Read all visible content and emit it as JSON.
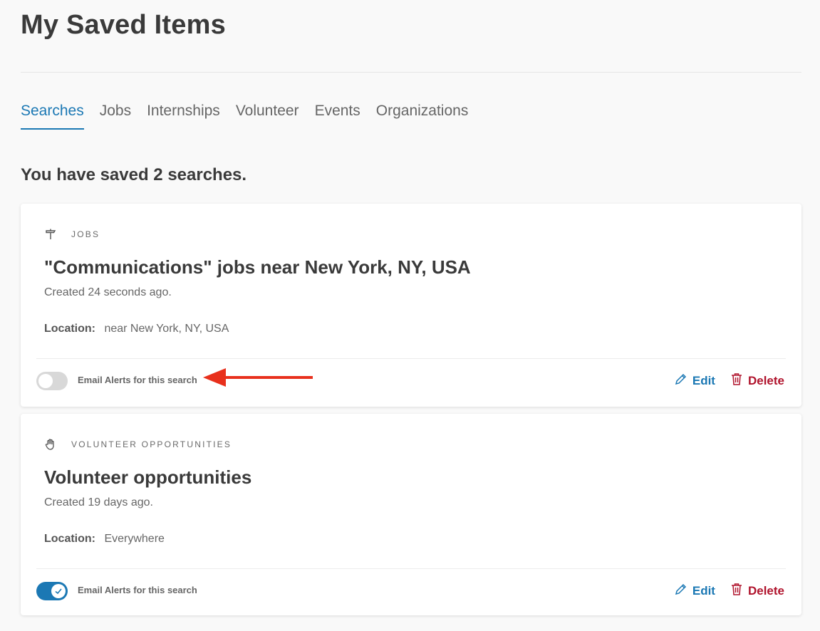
{
  "page": {
    "title": "My Saved Items"
  },
  "tabs": [
    {
      "label": "Searches",
      "active": true
    },
    {
      "label": "Jobs",
      "active": false
    },
    {
      "label": "Internships",
      "active": false
    },
    {
      "label": "Volunteer",
      "active": false
    },
    {
      "label": "Events",
      "active": false
    },
    {
      "label": "Organizations",
      "active": false
    }
  ],
  "summary": "You have saved 2 searches.",
  "searches": [
    {
      "category": "JOBS",
      "category_icon": "signpost-icon",
      "title": "\"Communications\" jobs near New York, NY, USA",
      "created": "Created 24 seconds ago.",
      "location_label": "Location:",
      "location_value": "near New York, NY, USA",
      "email_alert_label": "Email Alerts for this search",
      "email_alerts_on": false,
      "edit_label": "Edit",
      "delete_label": "Delete"
    },
    {
      "category": "VOLUNTEER OPPORTUNITIES",
      "category_icon": "hand-icon",
      "title": "Volunteer opportunities",
      "created": "Created 19 days ago.",
      "location_label": "Location:",
      "location_value": "Everywhere",
      "email_alert_label": "Email Alerts for this search",
      "email_alerts_on": true,
      "edit_label": "Edit",
      "delete_label": "Delete"
    }
  ],
  "colors": {
    "accent": "#1b78b4",
    "delete": "#b0132c",
    "annotation_arrow": "#e8301c"
  }
}
